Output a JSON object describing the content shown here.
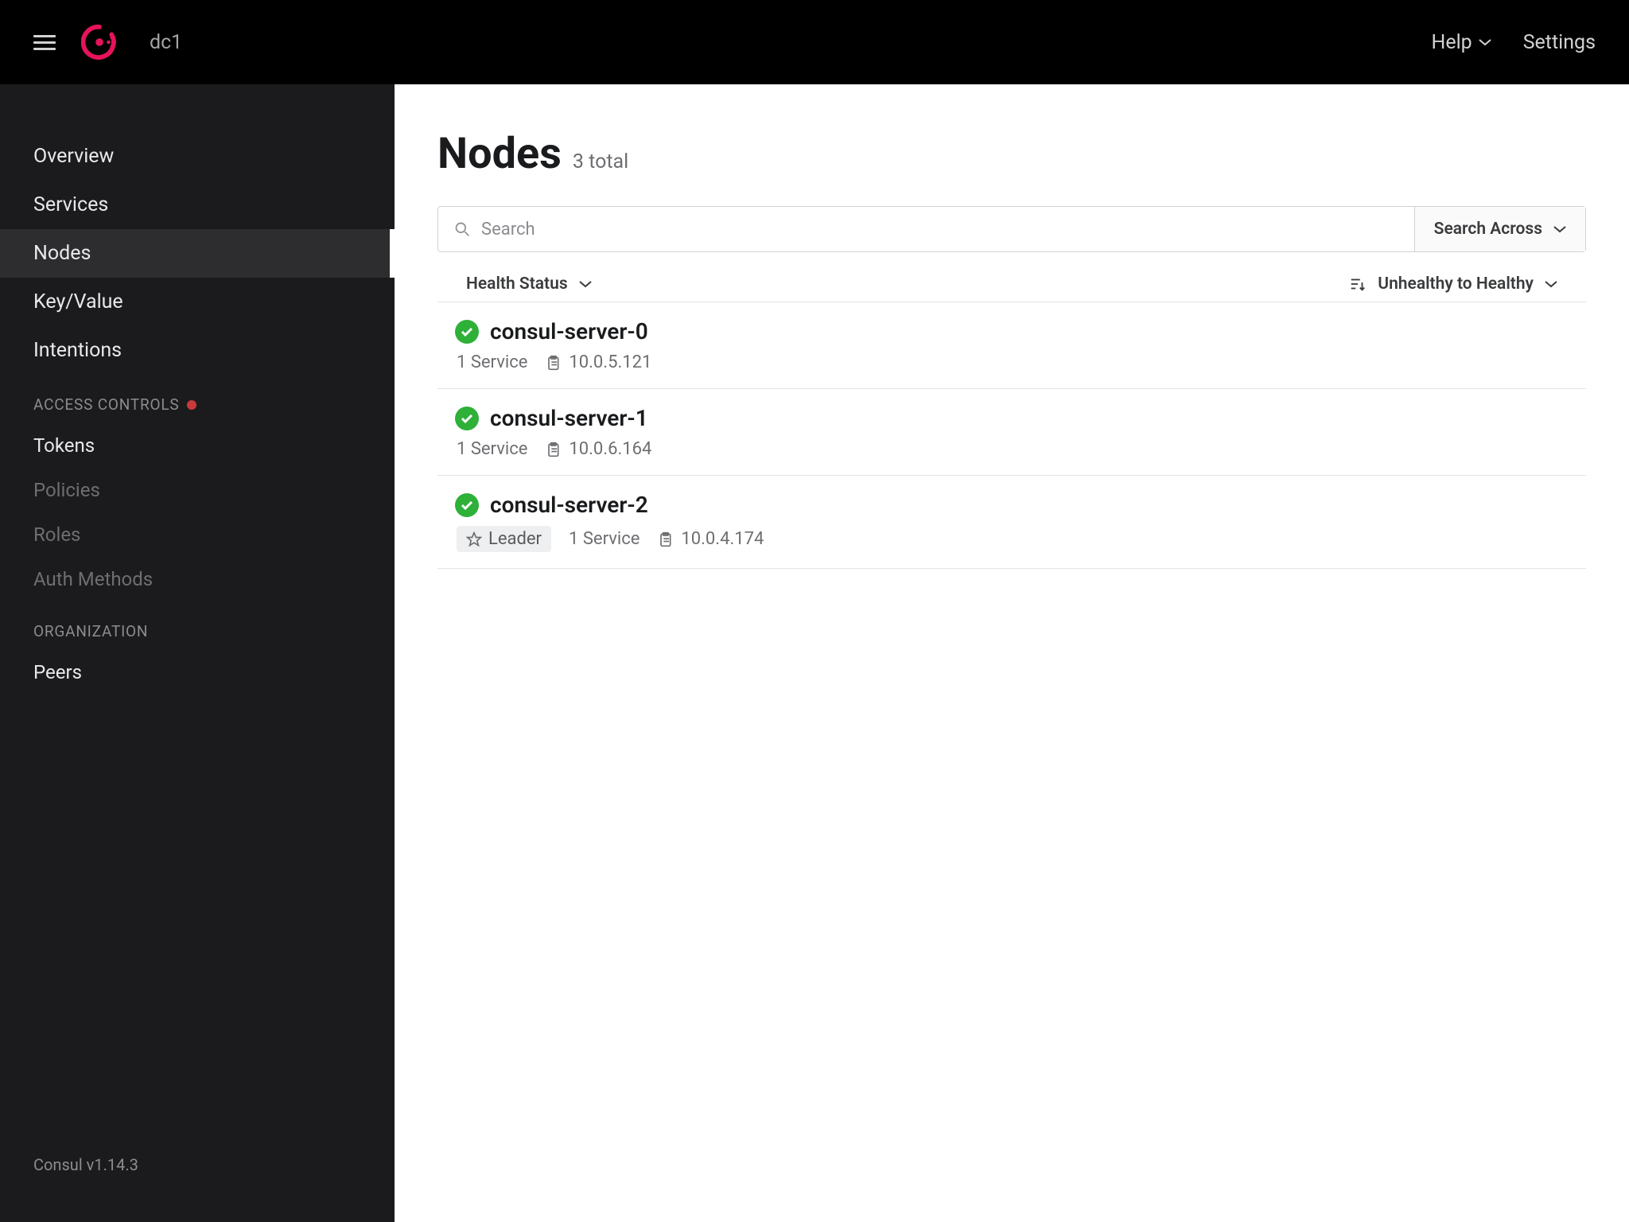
{
  "header": {
    "datacenter": "dc1",
    "help": "Help",
    "settings": "Settings"
  },
  "sidebar": {
    "main_items": [
      {
        "label": "Overview",
        "active": false
      },
      {
        "label": "Services",
        "active": false
      },
      {
        "label": "Nodes",
        "active": true
      },
      {
        "label": "Key/Value",
        "active": false
      },
      {
        "label": "Intentions",
        "active": false
      }
    ],
    "access_controls_title": "ACCESS CONTROLS",
    "access_controls_items": [
      {
        "label": "Tokens",
        "enabled": true
      },
      {
        "label": "Policies",
        "enabled": false
      },
      {
        "label": "Roles",
        "enabled": false
      },
      {
        "label": "Auth Methods",
        "enabled": false
      }
    ],
    "organization_title": "ORGANIZATION",
    "organization_items": [
      {
        "label": "Peers",
        "enabled": true
      }
    ],
    "footer": "Consul v1.14.3"
  },
  "main": {
    "title": "Nodes",
    "subtitle": "3 total",
    "search_placeholder": "Search",
    "search_across": "Search Across",
    "filter_health": "Health Status",
    "filter_sort": "Unhealthy to Healthy",
    "nodes": [
      {
        "name": "consul-server-0",
        "services": "1 Service",
        "ip": "10.0.5.121",
        "leader": false
      },
      {
        "name": "consul-server-1",
        "services": "1 Service",
        "ip": "10.0.6.164",
        "leader": false
      },
      {
        "name": "consul-server-2",
        "services": "1 Service",
        "ip": "10.0.4.174",
        "leader": true
      }
    ],
    "leader_label": "Leader"
  }
}
